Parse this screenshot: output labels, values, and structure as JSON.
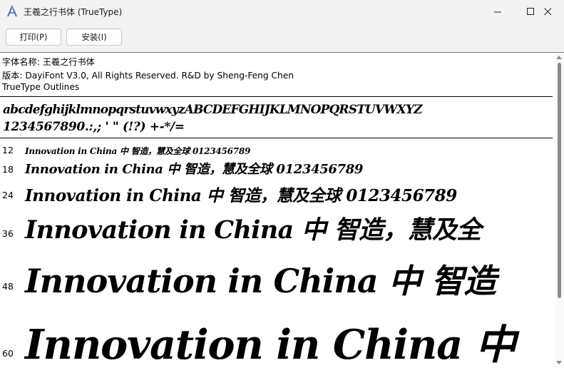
{
  "window": {
    "title": "王羲之行书体 (TrueType)",
    "controls": {
      "minimize": "—",
      "maximize": "☐",
      "close": "✕"
    }
  },
  "toolbar": {
    "print_label": "打印(P)",
    "install_label": "安装(I)"
  },
  "font_info": {
    "name_line": "字体名称: 王羲之行书体",
    "version_line": "版本: DayiFont V3.0, All Rights Reserved. R&D by Sheng-Feng Chen",
    "outline_type": "TrueType Outlines"
  },
  "charset": {
    "letters": "abcdefghijklmnopqrstuvwxyzABCDEFGHIJKLMNOPQRSTUVWXYZ",
    "digits_symbols": "1234567890.:,; ' \" (!?) +-*/="
  },
  "samples": [
    {
      "size": "12",
      "text": "Innovation in China 中    智造，慧及全球 0123456789"
    },
    {
      "size": "18",
      "text": "Innovation in China 中    智造，慧及全球 0123456789"
    },
    {
      "size": "24",
      "text": "Innovation in China 中    智造，慧及全球 0123456789"
    },
    {
      "size": "36",
      "text": "Innovation in China 中    智造，慧及全"
    },
    {
      "size": "48",
      "text": "Innovation in China 中    智造"
    },
    {
      "size": "60",
      "text": "Innovation in China 中"
    }
  ],
  "icons": {
    "app": "font-file-icon",
    "scroll_up": "chevron-up-icon",
    "scroll_down": "chevron-down-icon"
  },
  "colors": {
    "chrome_bg": "#f3f3f3",
    "content_bg": "#ffffff",
    "text": "#000000",
    "accent_icon": "#4b5fc1"
  }
}
